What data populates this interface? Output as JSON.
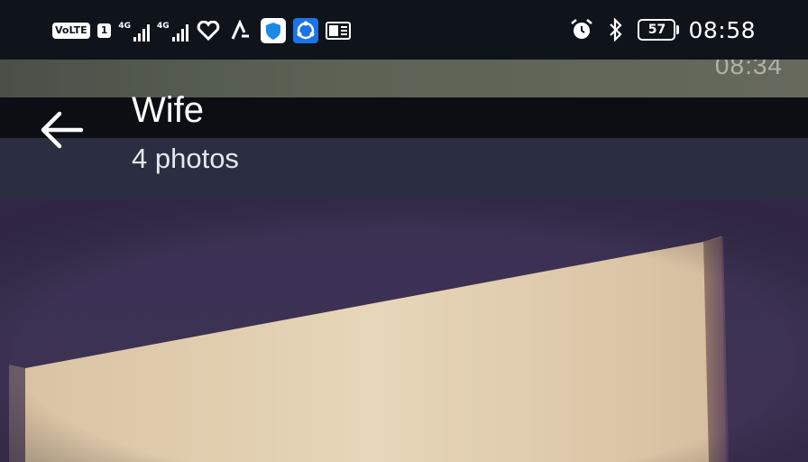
{
  "status_bar": {
    "volte_label": "VoLTE",
    "sim_label": "1",
    "network1_label": "4G",
    "network2_label": "4G",
    "battery_level": "57",
    "time": "08:58"
  },
  "background_timestamp": "08:34",
  "header": {
    "title": "Wife",
    "subtitle": "4 photos"
  },
  "icons": [
    "volte-icon",
    "signal-icon",
    "signal-icon",
    "heart-app-icon",
    "a-app-icon",
    "shield-app-icon",
    "share-app-icon",
    "office-app-icon",
    "alarm-icon",
    "bluetooth-icon",
    "battery-icon",
    "back-arrow-icon"
  ],
  "colors": {
    "status_bar_bg": "#0f141b",
    "header_bg": "#2b2d3f",
    "shield_blue": "#1e88e5"
  }
}
